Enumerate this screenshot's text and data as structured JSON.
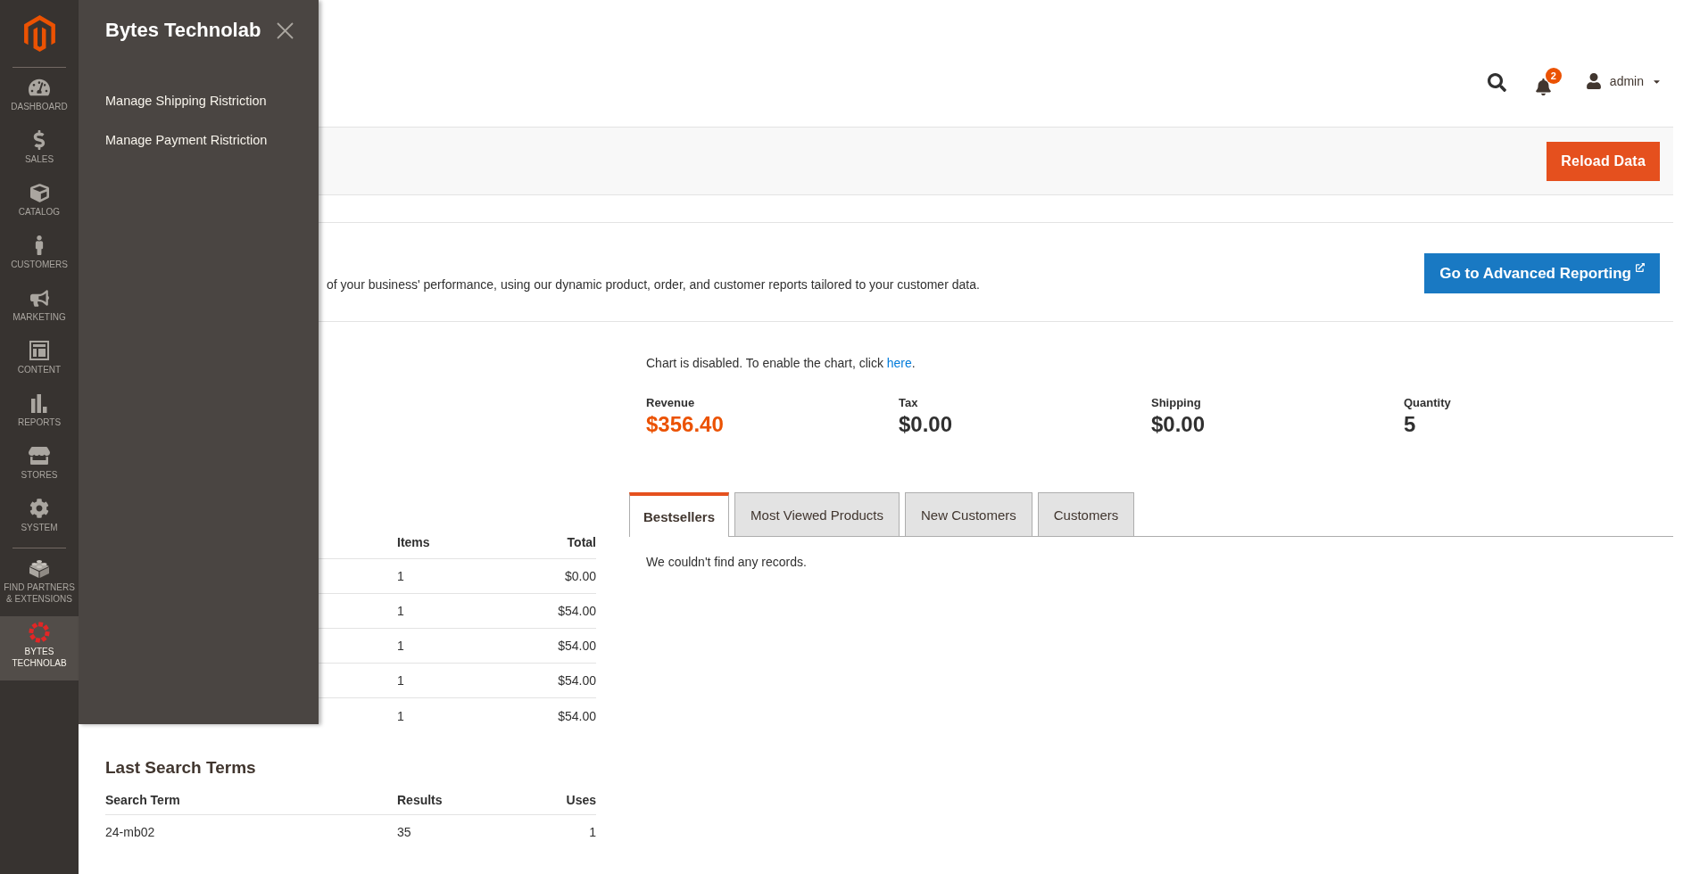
{
  "sidebar": {
    "groups": [
      {
        "items": [
          {
            "kind": "dashboard",
            "label": "DASHBOARD",
            "selected": false
          },
          {
            "kind": "sales",
            "label": "SALES",
            "selected": false
          },
          {
            "kind": "catalog",
            "label": "CATALOG",
            "selected": false
          },
          {
            "kind": "customers",
            "label": "CUSTOMERS",
            "selected": false
          },
          {
            "kind": "marketing",
            "label": "MARKETING",
            "selected": false
          },
          {
            "kind": "content",
            "label": "CONTENT",
            "selected": false
          },
          {
            "kind": "reports",
            "label": "REPORTS",
            "selected": false
          },
          {
            "kind": "stores",
            "label": "STORES",
            "selected": false
          },
          {
            "kind": "system",
            "label": "SYSTEM",
            "selected": false
          }
        ]
      },
      {
        "items": [
          {
            "kind": "partners",
            "label": "FIND PARTNERS & EXTENSIONS",
            "selected": false
          },
          {
            "kind": "bytes",
            "label": "BYTES TECHNOLAB",
            "selected": true
          }
        ]
      }
    ]
  },
  "flyout": {
    "title": "Bytes Technolab",
    "items": [
      "Manage Shipping Ristriction",
      "Manage Payment Ristriction"
    ]
  },
  "header": {
    "notification_count": "2",
    "user_name": "admin"
  },
  "page_actions": {
    "buttons": [
      "Reload Data"
    ]
  },
  "advanced_reporting": {
    "description": "of your business' performance, using our dynamic product, order, and customer reports tailored to your customer data.",
    "button": "Go to Advanced Reporting"
  },
  "last_orders": {
    "columns": [
      "Items",
      "Total"
    ],
    "rows": [
      [
        "1",
        "$0.00"
      ],
      [
        "1",
        "$54.00"
      ],
      [
        "1",
        "$54.00"
      ],
      [
        "1",
        "$54.00"
      ],
      [
        "1",
        "$54.00"
      ]
    ]
  },
  "last_search_terms": {
    "title": "Last Search Terms",
    "columns": [
      "Search Term",
      "Results",
      "Uses"
    ],
    "rows": [
      [
        "24-mb02",
        "35",
        "1"
      ]
    ]
  },
  "chart_notice": {
    "text": "Chart is disabled. To enable the chart, click",
    "link": "here",
    "text_after": "."
  },
  "totals": [
    {
      "label": "Revenue",
      "value": "$356.40",
      "emphasized": true
    },
    {
      "label": "Tax",
      "value": "$0.00",
      "emphasized": false
    },
    {
      "label": "Shipping",
      "value": "$0.00",
      "emphasized": false
    },
    {
      "label": "Quantity",
      "value": "5",
      "emphasized": false
    }
  ],
  "tabs": [
    {
      "label": "Bestsellers",
      "selected": true
    },
    {
      "label": "Most Viewed Products",
      "selected": false
    },
    {
      "label": "New Customers",
      "selected": false
    },
    {
      "label": "Customers",
      "selected": false
    }
  ],
  "tab_panel": {
    "message": "We couldn't find any records."
  }
}
